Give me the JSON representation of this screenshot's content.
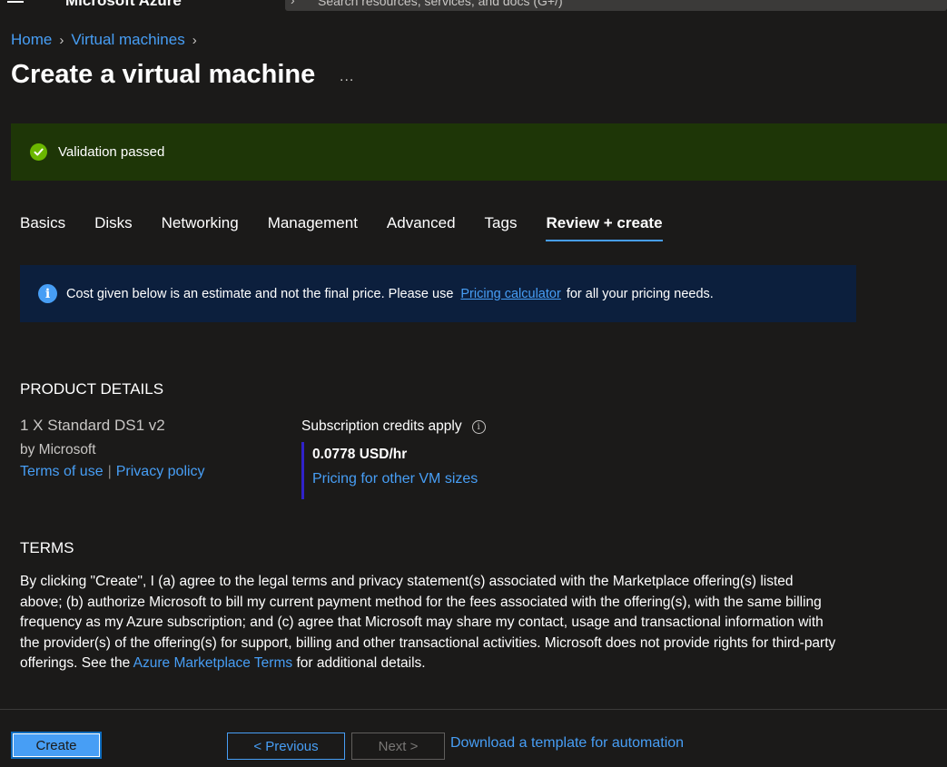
{
  "topbar": {
    "brand": "Microsoft Azure",
    "search_placeholder": "Search resources, services, and docs (G+/)"
  },
  "breadcrumb": {
    "items": [
      "Home",
      "Virtual machines"
    ]
  },
  "page": {
    "title": "Create a virtual machine",
    "more_label": "..."
  },
  "validation": {
    "text": "Validation passed"
  },
  "tabs": [
    {
      "label": "Basics"
    },
    {
      "label": "Disks"
    },
    {
      "label": "Networking"
    },
    {
      "label": "Management"
    },
    {
      "label": "Advanced"
    },
    {
      "label": "Tags"
    },
    {
      "label": "Review + create",
      "active": true
    }
  ],
  "info_banner": {
    "text_before": "Cost given below is an estimate and not the final price. Please use",
    "link": "Pricing calculator",
    "text_after": "for all your pricing needs."
  },
  "product_details": {
    "heading": "PRODUCT DETAILS",
    "name": "1 X Standard DS1 v2",
    "publisher": "by Microsoft",
    "terms_link": "Terms of use",
    "separator": "|",
    "privacy_link": "Privacy policy",
    "credits_label": "Subscription credits apply",
    "price": "0.0778 USD/hr",
    "pricing_link": "Pricing for other VM sizes"
  },
  "terms": {
    "heading": "TERMS",
    "body": "By clicking \"Create\", I (a) agree to the legal terms and privacy statement(s) associated with the Marketplace offering(s) listed above; (b) authorize Microsoft to bill my current payment method for the fees associated with the offering(s), with the same billing frequency as my Azure subscription; and (c) agree that Microsoft may share my contact, usage and transactional information with the provider(s) of the offering(s) for support, billing and other transactional activities. Microsoft does not provide rights for third-party offerings. See the",
    "link": "Azure Marketplace Terms",
    "tail": "for additional details."
  },
  "footer": {
    "create": "Create",
    "previous": "< Previous",
    "next": "Next >",
    "download": "Download a template for automation"
  },
  "colors": {
    "background": "#1b1a19",
    "accent": "#479ef5",
    "success_bar": "#1e3607",
    "success_icon": "#6bb700",
    "info_banner": "#0c1f3d"
  }
}
